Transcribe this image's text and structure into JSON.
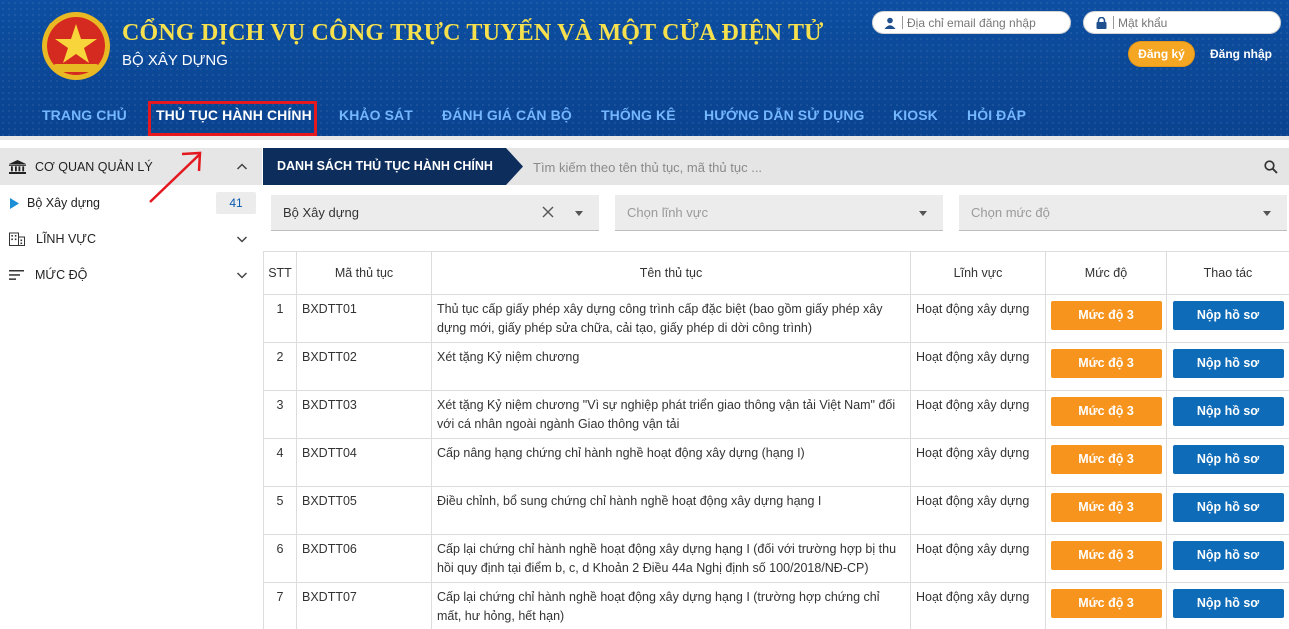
{
  "header": {
    "title": "CỔNG DỊCH VỤ CÔNG TRỰC TUYẾN VÀ MỘT CỬA ĐIỆN TỬ",
    "subtitle": "BỘ XÂY DỰNG",
    "email_placeholder": "Địa chỉ email đăng nhập",
    "password_placeholder": "Mật khẩu",
    "register_label": "Đăng ký",
    "login_label": "Đăng nhập"
  },
  "nav": {
    "items": [
      "TRANG CHỦ",
      "THỦ TỤC HÀNH CHÍNH",
      "KHẢO SÁT",
      "ĐÁNH GIÁ CÁN BỘ",
      "THỐNG KÊ",
      "HƯỚNG DẪN SỬ DỤNG",
      "KIOSK",
      "HỎI ĐÁP"
    ],
    "active": "THỦ TỤC HÀNH CHÍNH"
  },
  "sidebar": {
    "agency_header": "CƠ QUAN QUẢN LÝ",
    "agency_item": "Bộ Xây dựng",
    "agency_count": "41",
    "field_header": "LĨNH VỰC",
    "level_header": "MỨC ĐỘ"
  },
  "main": {
    "tab_title": "DANH SÁCH THỦ TỤC HÀNH CHÍNH",
    "search_placeholder": "Tìm kiếm theo tên thủ tục, mã thủ tục ...",
    "filter_agency": "Bộ Xây dựng",
    "filter_field_placeholder": "Chọn lĩnh vực",
    "filter_level_placeholder": "Chọn mức độ"
  },
  "table": {
    "headers": [
      "STT",
      "Mã thủ tục",
      "Tên thủ tục",
      "Lĩnh vực",
      "Mức độ",
      "Thao tác"
    ],
    "rows": [
      {
        "stt": "1",
        "code": "BXDTT01",
        "name": "Thủ tục cấp giấy phép xây dựng công trình cấp đặc biệt (bao gồm giấy phép xây dựng mới, giấy phép sửa chữa, cải tạo, giấy phép di dời công trình)",
        "field": "Hoạt động xây dựng",
        "level": "Mức độ 3",
        "action": "Nộp hồ sơ"
      },
      {
        "stt": "2",
        "code": "BXDTT02",
        "name": "Xét tặng Kỷ niệm chương",
        "field": "Hoạt động xây dựng",
        "level": "Mức độ 3",
        "action": "Nộp hồ sơ"
      },
      {
        "stt": "3",
        "code": "BXDTT03",
        "name": "Xét tặng Kỷ niệm chương \"Vì sự nghiệp phát triển giao thông vận tải Việt Nam\" đối với cá nhân ngoài ngành Giao thông vận tải",
        "field": "Hoạt động xây dựng",
        "level": "Mức độ 3",
        "action": "Nộp hồ sơ"
      },
      {
        "stt": "4",
        "code": "BXDTT04",
        "name": "Cấp nâng hạng chứng chỉ hành nghề hoạt động xây dựng (hạng I)",
        "field": "Hoạt động xây dựng",
        "level": "Mức độ 3",
        "action": "Nộp hồ sơ"
      },
      {
        "stt": "5",
        "code": "BXDTT05",
        "name": "Điều chỉnh, bổ sung chứng chỉ hành nghề hoạt động xây dựng hạng I",
        "field": "Hoạt động xây dựng",
        "level": "Mức độ 3",
        "action": "Nộp hồ sơ"
      },
      {
        "stt": "6",
        "code": "BXDTT06",
        "name": "Cấp lại chứng chỉ hành nghề hoạt động xây dựng hạng I (đối với trường hợp bị thu hồi quy định tại điểm b, c, d Khoản 2 Điều 44a Nghị định số 100/2018/NĐ-CP)",
        "field": "Hoạt động xây dựng",
        "level": "Mức độ 3",
        "action": "Nộp hồ sơ"
      },
      {
        "stt": "7",
        "code": "BXDTT07",
        "name": "Cấp lại chứng chỉ hành nghề hoạt động xây dựng hạng I (trường hợp chứng chỉ mất, hư hỏng, hết hạn)",
        "field": "Hoạt động xây dựng",
        "level": "Mức độ 3",
        "action": "Nộp hồ sơ"
      }
    ]
  },
  "colors": {
    "header_blue": "#0b4796",
    "title_yellow": "#f6e04d",
    "nav_inactive": "#75b7ff",
    "highlight_red": "#e3191f",
    "level_orange": "#f7941d",
    "submit_blue": "#0e6bb8",
    "tab_navy": "#0d2d5c"
  }
}
